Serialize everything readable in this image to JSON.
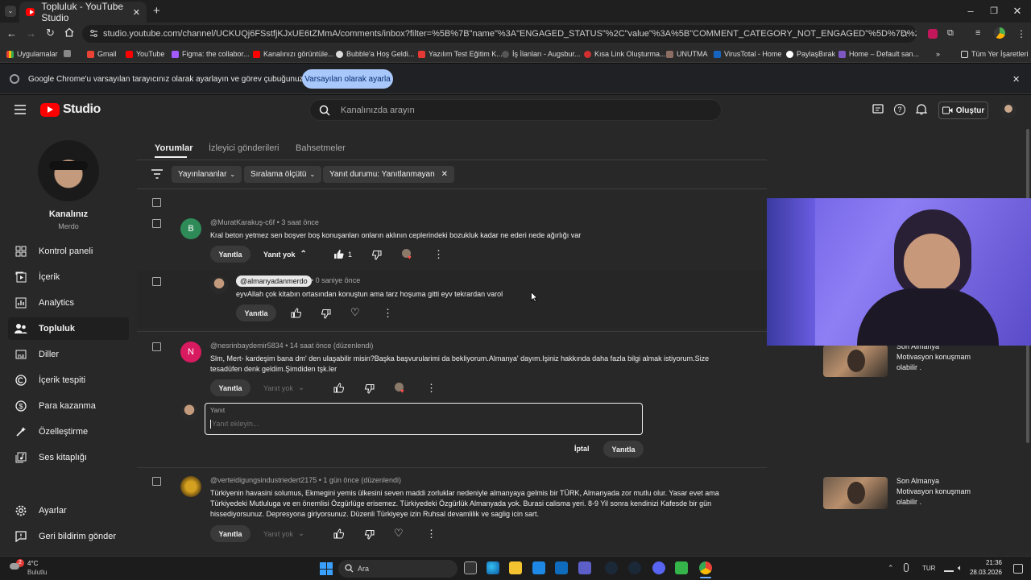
{
  "browser": {
    "tab_title": "Topluluk - YouTube Studio",
    "url": "studio.youtube.com/channel/UCKUQj6FSstfjKJxUE6tZMmA/comments/inbox?filter=%5B%7B\"name\"%3A\"ENGAGED_STATUS\"%2C\"value\"%3A%5B\"COMMENT_CATEGORY_NOT_ENGAGED\"%5D%7D%2C%7B\"isPinned\"%3Atrue%2C\"name\"...",
    "bookmarks": [
      "Uygulamalar",
      "Gmail",
      "YouTube",
      "Figma: the collabor...",
      "Kanalınızı görüntüle...",
      "Bubble'a Hoş Geldi...",
      "Yazılım Test Eğitim K...",
      "İş İlanları - Augsbur...",
      "Kısa Link Oluşturma...",
      "UNUTMA",
      "VirusTotal - Home",
      "PaylaşBırak",
      "Home – Default san..."
    ],
    "all_bookmarks": "Tüm Yer İşaretleri",
    "infobar_text": "Google Chrome'u varsayılan tarayıcınız olarak ayarlayın ve görev çubuğunuza sabitleyin",
    "infobar_button": "Varsayılan olarak ayarla"
  },
  "header": {
    "logo_text": "Studio",
    "search_placeholder": "Kanalınızda arayın",
    "create_label": "Oluştur"
  },
  "sidebar": {
    "channel_title": "Kanalınız",
    "channel_name": "Merdo",
    "items": [
      {
        "label": "Kontrol paneli",
        "icon": "dashboard-icon"
      },
      {
        "label": "İçerik",
        "icon": "content-icon"
      },
      {
        "label": "Analytics",
        "icon": "analytics-icon"
      },
      {
        "label": "Topluluk",
        "icon": "community-icon",
        "active": true
      },
      {
        "label": "Diller",
        "icon": "subtitles-icon"
      },
      {
        "label": "İçerik tespiti",
        "icon": "copyright-icon"
      },
      {
        "label": "Para kazanma",
        "icon": "monetization-icon"
      },
      {
        "label": "Özelleştirme",
        "icon": "customization-icon"
      },
      {
        "label": "Ses kitaplığı",
        "icon": "audio-library-icon"
      }
    ],
    "settings": "Ayarlar",
    "feedback": "Geri bildirim gönder"
  },
  "tabs": [
    "Yorumlar",
    "İzleyici gönderileri",
    "Bahsetmeler"
  ],
  "filters": {
    "published": "Yayınlananlar",
    "sort": "Sıralama ölçütü",
    "reply_status": "Yanıt durumu: Yanıtlanmayan"
  },
  "comments": [
    {
      "avatar_letter": "B",
      "avatar_color": "#2e8b57",
      "handle": "@MuratKarakuş-c6f",
      "time": "3 saat önce",
      "text": "Kral beton yetmez sen boşver boş konuşanları onların aklının ceplerindeki bozukluk kadar ne ederi nede ağırlığı var",
      "reply_label": "Yanıtla",
      "replies_label": "Yanıt yok",
      "likes": "1"
    },
    {
      "owner_badge": "@almanyadanmerdo",
      "time": "0 saniye önce",
      "text": "eyvAllah çok kitabın ortasından konuştun ama tarz hoşuma gitti eyv tekrardan varol",
      "reply_label": "Yanıtla"
    },
    {
      "avatar_letter": "N",
      "avatar_color": "#d81b60",
      "handle": "@nesrinbaydemir5834",
      "time": "14 saat önce (düzenlendi)",
      "text1": "Slm, Mert- kardeşim bana dm' den ulaşabilir misin?Başka başvurularimi da bekliyorum.Almanya' dayım.Işiniz hakkında daha fazla bilgi almak istiyorum.Size",
      "text2": "tesadüfen denk geldim.Şimdiden tşk.ler",
      "reply_label": "Yanıtla",
      "replies_label": "Yanıt yok",
      "video_title": "Son Almanya Motivasyon konuşmam olabilir ."
    },
    {
      "handle": "@verteidigungsindustriedert2175",
      "time": "1 gün önce (düzenlendi)",
      "text1": "Türkiyenin havasini solumus, Ekmegini yemis ülkesini seven maddi zorluklar nedeniyle almanyaya gelmis  bir TÜRK, Almanyada zor mutlu olur. Yasar evet ama",
      "text2": "Türkiyedeki Mutluluga ve en önemlisi Özgürlüge erisemez. Türkiyedeki Özgürlük Almanyada yok. Burasi calisma yeri. 8-9 Yil sonra kendinizi Kafesde bir gün",
      "text3": "hissediyorsunuz. Depresyona giriyorsunuz. Düzenli Türkiyeye izin Ruhsal devamlilik ve saglig icin sart.",
      "reply_label": "Yanıtla",
      "replies_label": "Yanıt yok",
      "video_title": "Son Almanya Motivasyon konuşmam olabilir ."
    }
  ],
  "reply_box": {
    "label": "Yanıt",
    "placeholder": "Yanıt ekleyin...",
    "cancel": "İptal",
    "submit": "Yanıtla"
  },
  "taskbar": {
    "weather_temp": "4°C",
    "weather_desc": "Bulutlu",
    "weather_badge": "2",
    "search": "Ara",
    "lang": "TUR",
    "time": "21:36",
    "date": "28.03.2026"
  }
}
